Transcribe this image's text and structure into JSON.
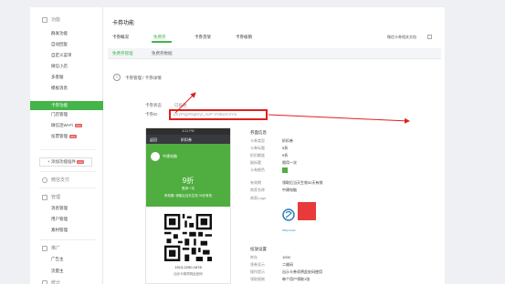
{
  "sidebar": {
    "sections": [
      {
        "label": "功能",
        "icon": "grid-icon",
        "items": [
          "群发功能",
          "自动回复",
          "自定义菜单",
          "微信小店",
          "多客服",
          "模板消息",
          "卡券功能",
          "门店管理",
          "微信连Wi-Fi",
          "投票管理"
        ]
      },
      {
        "label": "微信支付",
        "icon": "wallet-icon"
      },
      {
        "label": "管理",
        "icon": "manage-icon",
        "items": [
          "消息管理",
          "用户管理",
          "素材管理"
        ]
      },
      {
        "label": "推广",
        "icon": "promo-icon",
        "items": [
          "广告主",
          "流量主"
        ]
      },
      {
        "label": "统计",
        "icon": "chart-icon"
      }
    ],
    "active_item": "卡券功能",
    "new_badge": "new",
    "add_plugin": "+ 添加功能插件",
    "add_plugin_badge": "new"
  },
  "main": {
    "title": "卡券功能",
    "tabs": [
      "卡券概况",
      "免费券",
      "卡券货架",
      "卡券核销"
    ],
    "active_tab": "免费券",
    "api_checkbox_label": "微信卡券相关文档",
    "subtabs": [
      "免费券管理",
      "免费券数据"
    ],
    "breadcrumb": "卡券管理 / 卡券详情",
    "status_label": "卡券状态",
    "status_value": "已投放",
    "id_label": "卡券ID",
    "id_value": "pXyPsjyRkgEtyt_ouP-YAt8wm3Yw"
  },
  "preview": {
    "status_time": "4:21 PM",
    "back": "返回",
    "nav_title": "折扣券",
    "merchant": "中建电脑",
    "discount": "9折",
    "use_times": "限用一次",
    "validity": "有效期: 领取后当天生效 30天有效",
    "code": "1513-2250-1878",
    "hint": "出示卡券须将此处码"
  },
  "info": {
    "heading": "券面信息",
    "rows": [
      {
        "label": "卡券类型",
        "value": "折扣券"
      },
      {
        "label": "卡券标题",
        "value": "9折"
      },
      {
        "label": "折扣额度",
        "value": "9折"
      },
      {
        "label": "副标题",
        "value": "限用一次"
      },
      {
        "label": "卡券颜色",
        "value": ""
      },
      {
        "label": "有效期",
        "value": "领取后当天生效30天有效"
      },
      {
        "label": "商家名称",
        "value": "中建电脑"
      },
      {
        "label": "商家Logo",
        "value": ""
      }
    ],
    "card_color": "#4fae3f",
    "logo_caption": "SSSymcoder",
    "logo_color": "#e83a3a"
  },
  "delivery": {
    "heading": "投放设置",
    "rows": [
      {
        "label": "库存",
        "value": "1000"
      },
      {
        "label": "领券显示",
        "value": "二维码"
      },
      {
        "label": "操作提示",
        "value": "出示卡券须将此处码使用"
      },
      {
        "label": "领取限制",
        "value": "每个用户领取1张"
      }
    ]
  },
  "colors": {
    "accent": "#44b549",
    "alert": "#e0201c",
    "card": "#4fae3f"
  }
}
